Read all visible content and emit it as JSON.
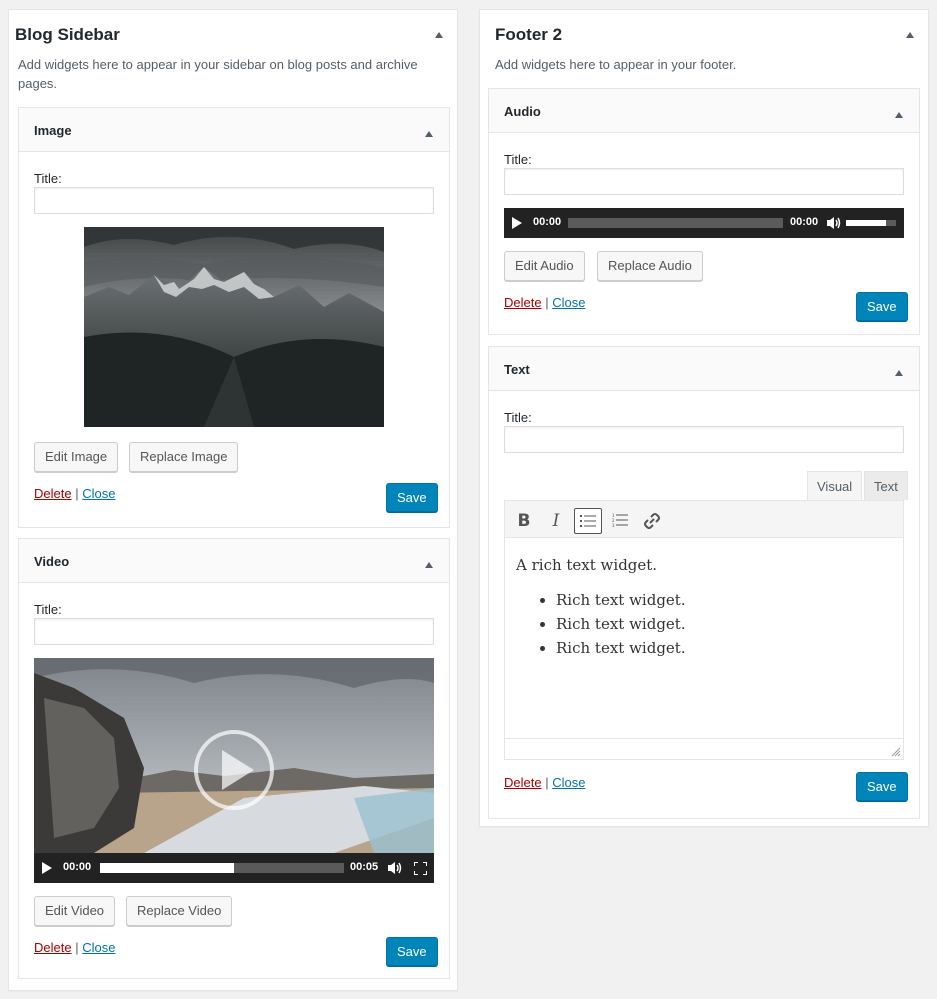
{
  "blog_sidebar": {
    "title": "Blog Sidebar",
    "description": "Add widgets here to appear in your sidebar on blog posts and archive pages.",
    "widgets": {
      "image": {
        "name": "Image",
        "title_label": "Title:",
        "title_value": "",
        "edit_label": "Edit Image",
        "replace_label": "Replace Image",
        "delete_label": "Delete",
        "separator": "|",
        "close_label": "Close",
        "save_label": "Save"
      },
      "video": {
        "name": "Video",
        "title_label": "Title:",
        "title_value": "",
        "current_time": "00:00",
        "duration": "00:05",
        "progress": 0.55,
        "edit_label": "Edit Video",
        "replace_label": "Replace Video",
        "delete_label": "Delete",
        "separator": "|",
        "close_label": "Close",
        "save_label": "Save"
      }
    }
  },
  "footer_2": {
    "title": "Footer 2",
    "description": "Add widgets here to appear in your footer.",
    "widgets": {
      "audio": {
        "name": "Audio",
        "title_label": "Title:",
        "title_value": "",
        "current_time": "00:00",
        "duration": "00:00",
        "volume": 0.8,
        "edit_label": "Edit Audio",
        "replace_label": "Replace Audio",
        "delete_label": "Delete",
        "separator": "|",
        "close_label": "Close",
        "save_label": "Save"
      },
      "text": {
        "name": "Text",
        "title_label": "Title:",
        "title_value": "",
        "tab_visual": "Visual",
        "tab_text": "Text",
        "toolbar": [
          "bold-icon",
          "italic-icon",
          "bullet-list-icon",
          "numbered-list-icon",
          "link-icon"
        ],
        "content_paragraph": "A rich text widget.",
        "content_list": [
          "Rich text widget.",
          "Rich text widget.",
          "Rich text widget."
        ],
        "delete_label": "Delete",
        "separator": "|",
        "close_label": "Close",
        "save_label": "Save"
      }
    }
  },
  "colors": {
    "primary_button": "#0085ba",
    "delete_link": "#aa0000",
    "close_link": "#0073aa",
    "media_bar": "#222222"
  }
}
